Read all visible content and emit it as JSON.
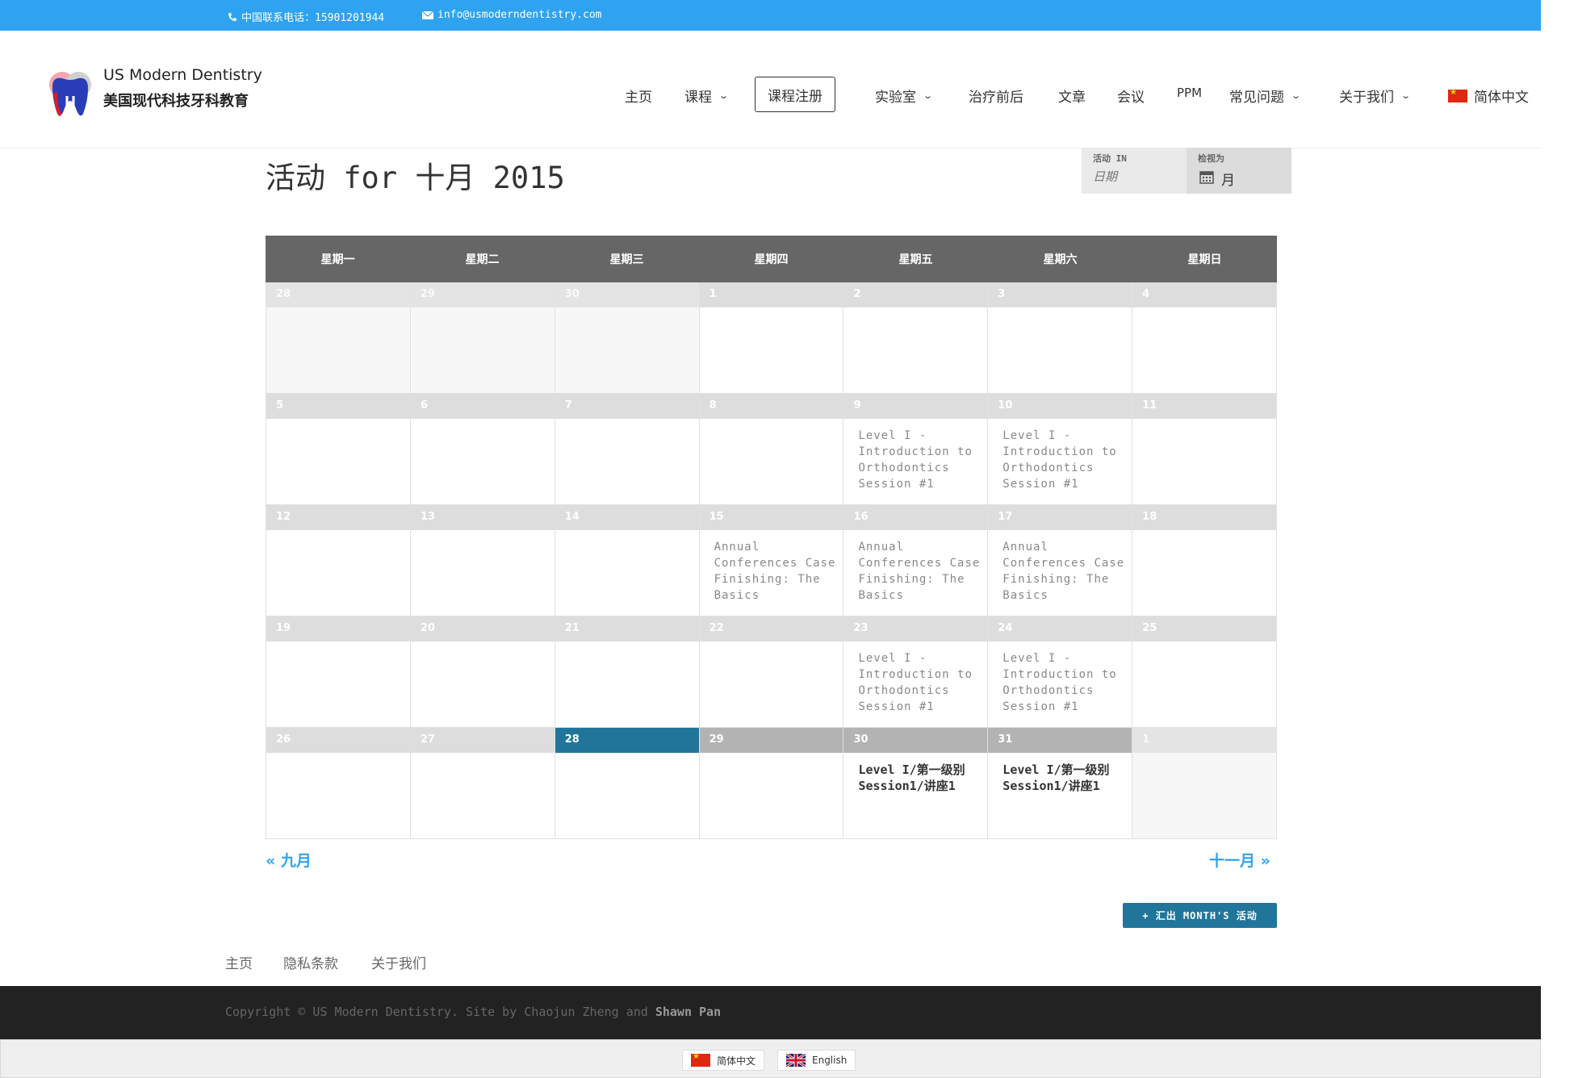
{
  "topbar": {
    "phone": "中国联系电话：15901201944",
    "email": "info@usmoderndentistry.com",
    "phone_icon": "phone-icon",
    "email_icon": "envelope-icon"
  },
  "brand": {
    "name_en": "US Modern Dentistry",
    "name_cn": "美国现代科技牙科教育"
  },
  "nav": {
    "home": "主页",
    "courses": "课程",
    "register": "课程注册",
    "lab": "实验室",
    "before_after": "治疗前后",
    "articles": "文章",
    "meetings": "会议",
    "ppm": "PPM",
    "faq": "常见问题",
    "about": "关于我们",
    "language": "简体中文"
  },
  "calendar": {
    "title": "活动 for 十月 2015",
    "filter_label": "活动 IN",
    "filter_placeholder": "日期",
    "view_label": "检视为",
    "view_value": "月",
    "weekdays": [
      "星期一",
      "星期二",
      "星期三",
      "星期四",
      "星期五",
      "星期六",
      "星期日"
    ],
    "weeks": [
      [
        {
          "d": "28",
          "t": "other"
        },
        {
          "d": "29",
          "t": "other"
        },
        {
          "d": "30",
          "t": "other"
        },
        {
          "d": "1",
          "t": "past"
        },
        {
          "d": "2",
          "t": "past"
        },
        {
          "d": "3",
          "t": "past"
        },
        {
          "d": "4",
          "t": "past"
        }
      ],
      [
        {
          "d": "5",
          "t": "past"
        },
        {
          "d": "6",
          "t": "past"
        },
        {
          "d": "7",
          "t": "past"
        },
        {
          "d": "8",
          "t": "past"
        },
        {
          "d": "9",
          "t": "past",
          "ev": "Level I - Introduction to Orthodontics Session #1"
        },
        {
          "d": "10",
          "t": "past",
          "ev": "Level I - Introduction to Orthodontics Session #1"
        },
        {
          "d": "11",
          "t": "past"
        }
      ],
      [
        {
          "d": "12",
          "t": "past"
        },
        {
          "d": "13",
          "t": "past"
        },
        {
          "d": "14",
          "t": "past"
        },
        {
          "d": "15",
          "t": "past",
          "ev": "Annual Conferences Case Finishing: The Basics"
        },
        {
          "d": "16",
          "t": "past",
          "ev": "Annual Conferences Case Finishing: The Basics"
        },
        {
          "d": "17",
          "t": "past",
          "ev": "Annual Conferences Case Finishing: The Basics"
        },
        {
          "d": "18",
          "t": "past"
        }
      ],
      [
        {
          "d": "19",
          "t": "past"
        },
        {
          "d": "20",
          "t": "past"
        },
        {
          "d": "21",
          "t": "past"
        },
        {
          "d": "22",
          "t": "past"
        },
        {
          "d": "23",
          "t": "past",
          "ev": "Level I - Introduction to Orthodontics Session #1"
        },
        {
          "d": "24",
          "t": "past",
          "ev": "Level I - Introduction to Orthodontics Session #1"
        },
        {
          "d": "25",
          "t": "past"
        }
      ],
      [
        {
          "d": "26",
          "t": "past"
        },
        {
          "d": "27",
          "t": "past"
        },
        {
          "d": "28",
          "t": "today"
        },
        {
          "d": "29",
          "t": "future"
        },
        {
          "d": "30",
          "t": "future",
          "ev": "Level I/第一级别 Session1/讲座1",
          "strong": true
        },
        {
          "d": "31",
          "t": "future",
          "ev": "Level I/第一级别 Session1/讲座1",
          "strong": true
        },
        {
          "d": "1",
          "t": "other"
        }
      ]
    ],
    "prev_month": "« 九月",
    "next_month": "十一月 »",
    "export": "+ 汇出 MONTH'S 活动"
  },
  "footer_nav": {
    "home": "主页",
    "privacy": "隐私条款",
    "about": "关于我们"
  },
  "footer": {
    "copyright_prefix": "Copyright © US Modern Dentistry. Site by Chaojun Zheng and ",
    "copyright_name": "Shawn Pan"
  },
  "language_switcher": {
    "cn": "简体中文",
    "en": "English"
  },
  "colors": {
    "topbar": "#2ea3f2",
    "today": "#21759b",
    "header_row": "#666666",
    "link": "#2ea3f2"
  }
}
